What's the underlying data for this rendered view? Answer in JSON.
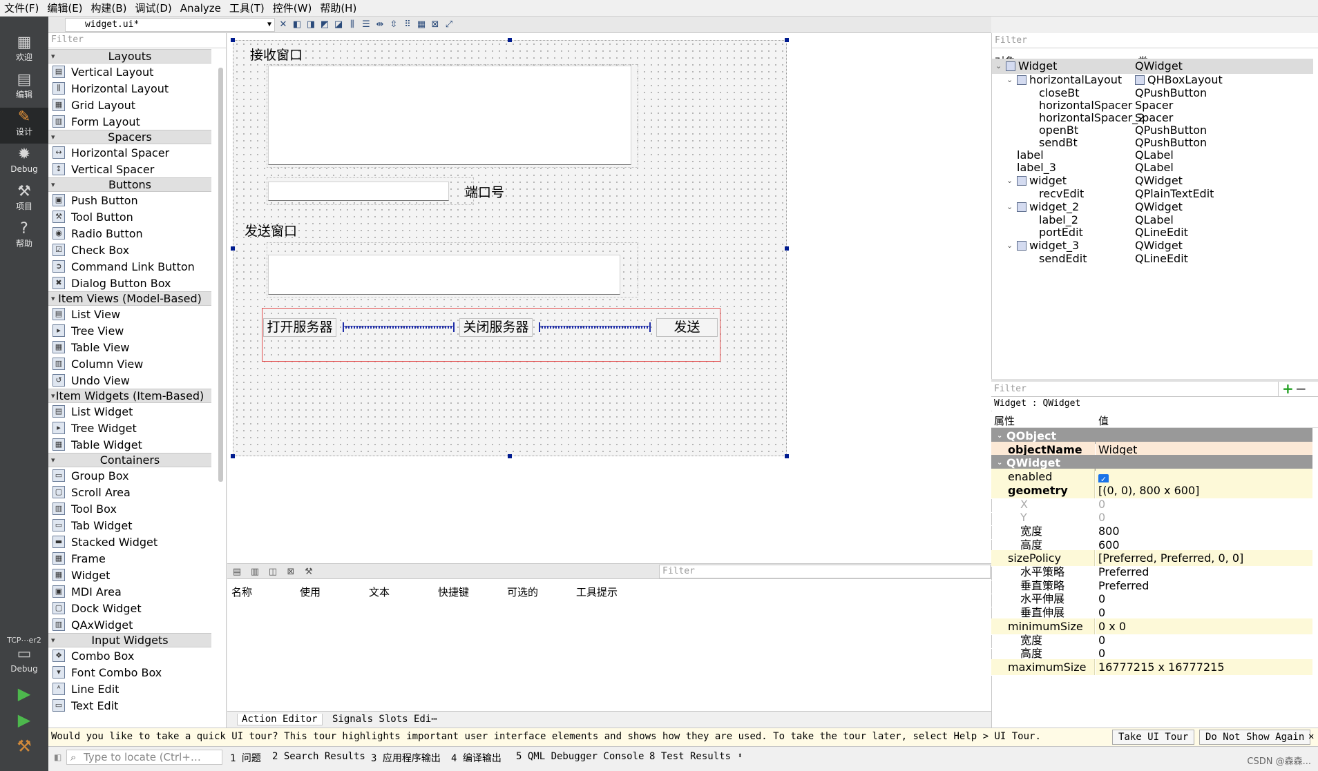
{
  "menu": [
    "文件(F)",
    "编辑(E)",
    "构建(B)",
    "调试(D)",
    "Analyze",
    "工具(T)",
    "控件(W)",
    "帮助(H)"
  ],
  "modes": [
    {
      "label": "欢迎",
      "icon": "grid-icon"
    },
    {
      "label": "编辑",
      "icon": "edit-icon"
    },
    {
      "label": "设计",
      "icon": "design-pen-icon"
    },
    {
      "label": "Debug",
      "icon": "bug-icon"
    },
    {
      "label": "项目",
      "icon": "wrench-icon"
    },
    {
      "label": "帮助",
      "icon": "help-icon"
    }
  ],
  "kit": {
    "project": "TCP⋯er2",
    "config": "Debug"
  },
  "document": {
    "name": "widget.ui*"
  },
  "widget_box": {
    "filter_placeholder": "Filter",
    "categories": [
      {
        "name": "Layouts",
        "items": [
          "Vertical Layout",
          "Horizontal Layout",
          "Grid Layout",
          "Form Layout"
        ]
      },
      {
        "name": "Spacers",
        "items": [
          "Horizontal Spacer",
          "Vertical Spacer"
        ]
      },
      {
        "name": "Buttons",
        "items": [
          "Push Button",
          "Tool Button",
          "Radio Button",
          "Check Box",
          "Command Link Button",
          "Dialog Button Box"
        ]
      },
      {
        "name": "Item Views (Model-Based)",
        "items": [
          "List View",
          "Tree View",
          "Table View",
          "Column View",
          "Undo View"
        ]
      },
      {
        "name": "Item Widgets (Item-Based)",
        "items": [
          "List Widget",
          "Tree Widget",
          "Table Widget"
        ]
      },
      {
        "name": "Containers",
        "items": [
          "Group Box",
          "Scroll Area",
          "Tool Box",
          "Tab Widget",
          "Stacked Widget",
          "Frame",
          "Widget",
          "MDI Area",
          "Dock Widget",
          "QAxWidget"
        ]
      },
      {
        "name": "Input Widgets",
        "items": [
          "Combo Box",
          "Font Combo Box",
          "Line Edit",
          "Text Edit"
        ]
      }
    ]
  },
  "form": {
    "recv_label": "接收窗口",
    "port_label": "端口号",
    "send_label": "发送窗口",
    "open_button": "打开服务器",
    "close_button": "关闭服务器",
    "send_button": "发送"
  },
  "action_editor": {
    "filter_placeholder": "Filter",
    "columns": [
      "名称",
      "使用",
      "文本",
      "快捷键",
      "可选的",
      "工具提示"
    ],
    "tabs": [
      "Action Editor",
      "Signals  Slots Edi⋯"
    ]
  },
  "object_inspector": {
    "filter_placeholder": "Filter",
    "columns": [
      "对象",
      "类"
    ],
    "rows": [
      {
        "name": "Widget",
        "cls": "QWidget"
      },
      {
        "name": "horizontalLayout",
        "cls": "QHBoxLayout"
      },
      {
        "name": "closeBt",
        "cls": "QPushButton"
      },
      {
        "name": "horizontalSpacer",
        "cls": "Spacer"
      },
      {
        "name": "horizontalSpacer_2",
        "cls": "Spacer"
      },
      {
        "name": "openBt",
        "cls": "QPushButton"
      },
      {
        "name": "sendBt",
        "cls": "QPushButton"
      },
      {
        "name": "label",
        "cls": "QLabel"
      },
      {
        "name": "label_3",
        "cls": "QLabel"
      },
      {
        "name": "widget",
        "cls": "QWidget"
      },
      {
        "name": "recvEdit",
        "cls": "QPlainTextEdit"
      },
      {
        "name": "widget_2",
        "cls": "QWidget"
      },
      {
        "name": "label_2",
        "cls": "QLabel"
      },
      {
        "name": "portEdit",
        "cls": "QLineEdit"
      },
      {
        "name": "widget_3",
        "cls": "QWidget"
      },
      {
        "name": "sendEdit",
        "cls": "QLineEdit"
      }
    ]
  },
  "property_editor": {
    "filter_placeholder": "Filter",
    "who": "Widget : QWidget",
    "columns": [
      "属性",
      "值"
    ],
    "rows": [
      {
        "name": "QObject",
        "value": ""
      },
      {
        "name": "objectName",
        "value": "Widget"
      },
      {
        "name": "QWidget",
        "value": ""
      },
      {
        "name": "enabled",
        "value": "✓"
      },
      {
        "name": "geometry",
        "value": "[(0, 0), 800 x 600]"
      },
      {
        "name": "X",
        "value": "0"
      },
      {
        "name": "Y",
        "value": "0"
      },
      {
        "name": "宽度",
        "value": "800"
      },
      {
        "name": "高度",
        "value": "600"
      },
      {
        "name": "sizePolicy",
        "value": "[Preferred, Preferred, 0, 0]"
      },
      {
        "name": "水平策略",
        "value": "Preferred"
      },
      {
        "name": "垂直策略",
        "value": "Preferred"
      },
      {
        "name": "水平伸展",
        "value": "0"
      },
      {
        "name": "垂直伸展",
        "value": "0"
      },
      {
        "name": "minimumSize",
        "value": "0 x 0"
      },
      {
        "name": "宽度",
        "value": "0"
      },
      {
        "name": "高度",
        "value": "0"
      },
      {
        "name": "maximumSize",
        "value": "16777215 x 16777215"
      }
    ]
  },
  "tour": {
    "message": "Would you like to take a quick UI tour? This tour highlights important user interface elements and shows how they are used. To take the tour later, select Help > UI Tour.",
    "take_button": "Take UI Tour",
    "dismiss_button": "Do Not Show Again"
  },
  "status": {
    "locate_placeholder": "Type to locate (Ctrl+…",
    "panes": [
      "1 问题",
      "2 Search Results",
      "3 应用程序输出",
      "4 编译输出",
      "5 QML Debugger Console",
      "8 Test Results"
    ],
    "watermark": "CSDN @森森..."
  }
}
